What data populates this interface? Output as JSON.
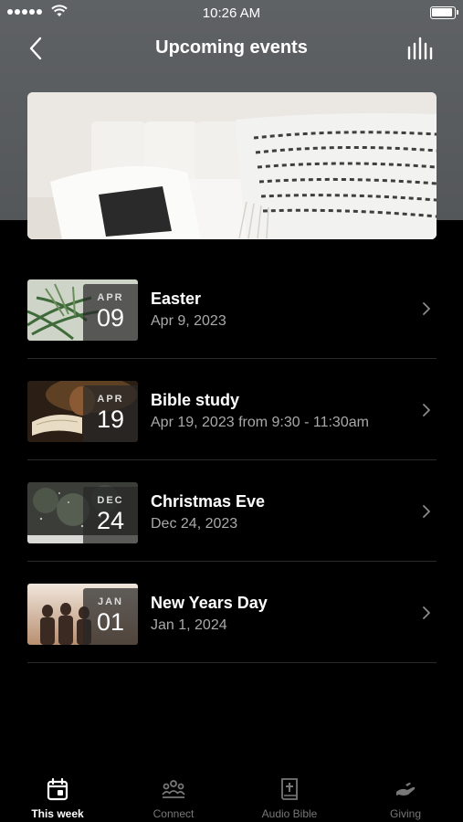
{
  "status_bar": {
    "time": "10:26 AM"
  },
  "header": {
    "title": "Upcoming events"
  },
  "events": [
    {
      "month": "APR",
      "day": "09",
      "title": "Easter",
      "subtitle": "Apr 9, 2023"
    },
    {
      "month": "APR",
      "day": "19",
      "title": "Bible study",
      "subtitle": "Apr 19, 2023 from 9:30 - 11:30am"
    },
    {
      "month": "DEC",
      "day": "24",
      "title": "Christmas Eve",
      "subtitle": "Dec 24, 2023"
    },
    {
      "month": "JAN",
      "day": "01",
      "title": "New Years Day",
      "subtitle": "Jan 1, 2024"
    }
  ],
  "tabs": [
    {
      "label": "This week",
      "icon": "calendar-icon",
      "active": true
    },
    {
      "label": "Connect",
      "icon": "people-icon",
      "active": false
    },
    {
      "label": "Audio Bible",
      "icon": "bible-icon",
      "active": false
    },
    {
      "label": "Giving",
      "icon": "giving-hand-icon",
      "active": false
    }
  ],
  "colors": {
    "background": "#000000",
    "header_gray": "#5f6264",
    "secondary_text": "#a9a9a9",
    "inactive_tab": "#777777"
  }
}
